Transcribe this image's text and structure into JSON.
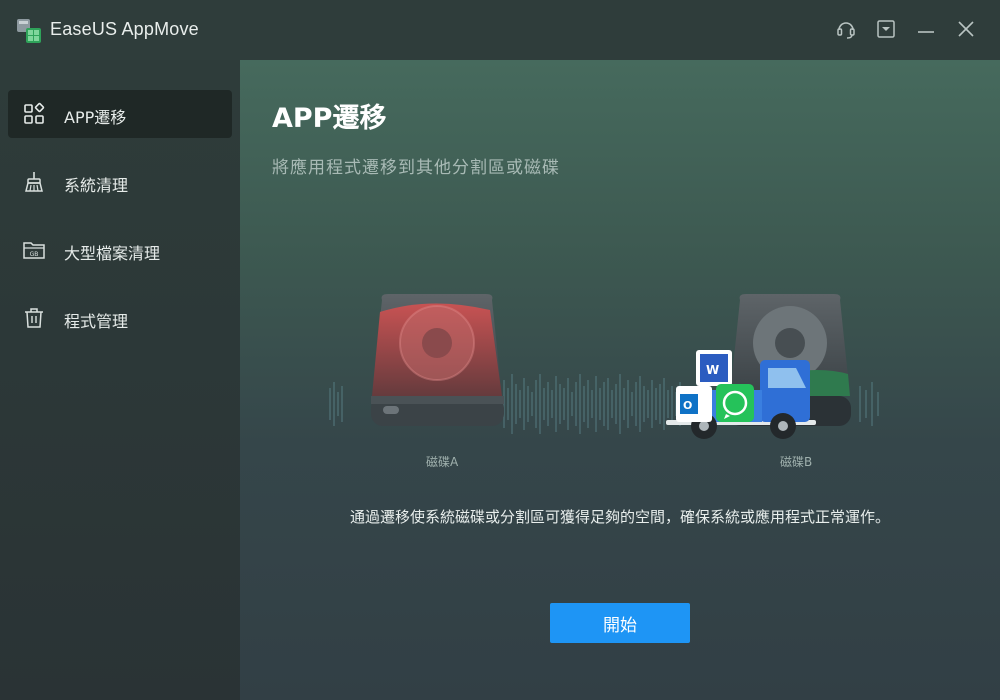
{
  "titlebar": {
    "app_title": "EaseUS AppMove",
    "icons": [
      "headset-icon",
      "dropdown-menu-icon",
      "minimize-icon",
      "close-icon"
    ]
  },
  "sidebar": {
    "items": [
      {
        "label": "APP遷移",
        "icon": "apps-grid-icon",
        "active": true
      },
      {
        "label": "系統清理",
        "icon": "broom-icon",
        "active": false
      },
      {
        "label": "大型檔案清理",
        "icon": "folder-gb-icon",
        "active": false
      },
      {
        "label": "程式管理",
        "icon": "trash-icon",
        "active": false
      }
    ]
  },
  "main": {
    "title": "APP遷移",
    "subtitle": "將應用程式遷移到其他分割區或磁碟",
    "disk_a_label": "磁碟A",
    "disk_b_label": "磁碟B",
    "description": "通過遷移使系統磁碟或分割區可獲得足夠的空間，確保系統或應用程式正常運作。",
    "start_label": "開始"
  },
  "colors": {
    "accent": "#1e95f5",
    "disk_a_accent": "#c84a4a",
    "disk_b_accent": "#2f7a4e",
    "truck": "#2f6fd6"
  }
}
